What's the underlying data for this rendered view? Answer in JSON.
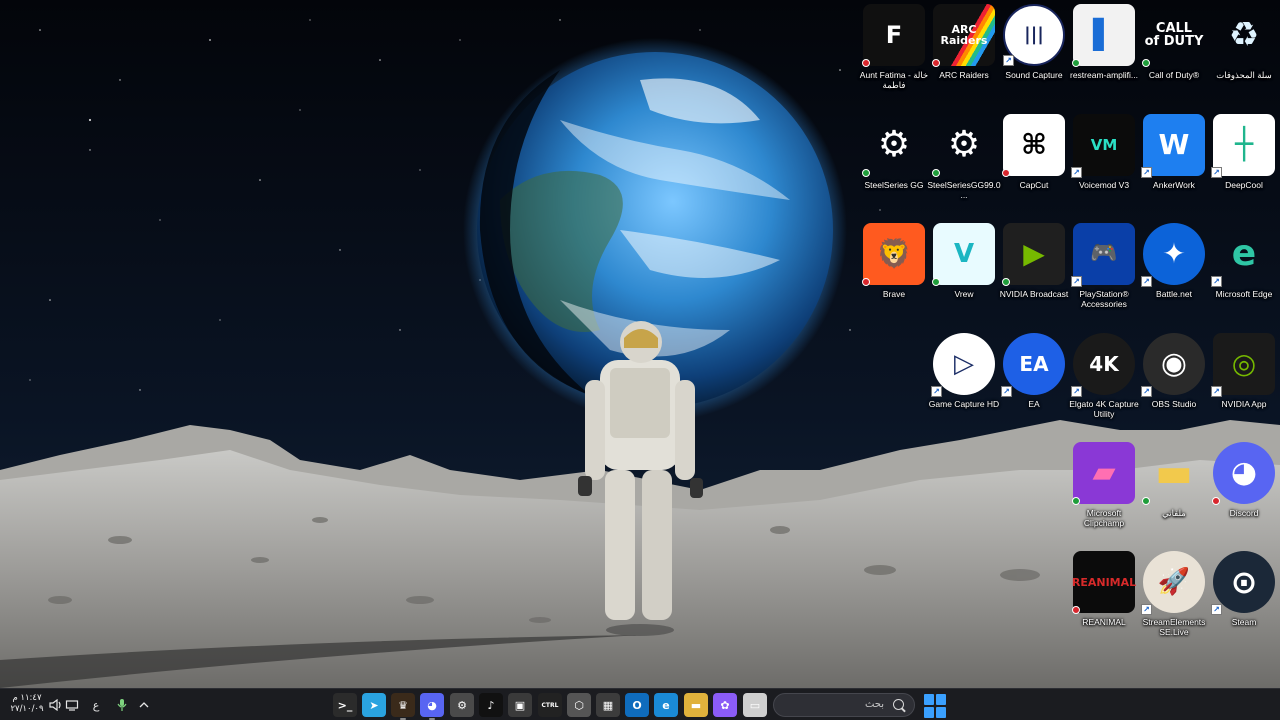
{
  "desktop": {
    "icons": [
      {
        "label": "Aunt Fatima - خالة فاطمة",
        "glyph": "F",
        "status": "err"
      },
      {
        "label": "ARC Raiders",
        "glyph": "ARC\nRaiders",
        "status": "err"
      },
      {
        "label": "Sound Capture",
        "glyph": "|||",
        "status": "shortcut"
      },
      {
        "label": "restream-amplifi...",
        "glyph": "▌",
        "status": "sync"
      },
      {
        "label": "Call of Duty®",
        "glyph": "CALL\nof DUTY",
        "status": "sync"
      },
      {
        "label": "سلة المحذوفات",
        "glyph": "♻",
        "status": "none"
      },
      {
        "label": "SteelSeries GG",
        "glyph": "⚙",
        "status": "sync"
      },
      {
        "label": "SteelSeriesGG99.0...",
        "glyph": "⚙",
        "status": "sync"
      },
      {
        "label": "CapCut",
        "glyph": "⌘",
        "status": "err"
      },
      {
        "label": "Voicemod V3",
        "glyph": "VM",
        "status": "shortcut"
      },
      {
        "label": "AnkerWork",
        "glyph": "W",
        "status": "shortcut"
      },
      {
        "label": "DeepCool",
        "glyph": "┼",
        "status": "shortcut"
      },
      {
        "label": "Brave",
        "glyph": "🦁",
        "status": "err"
      },
      {
        "label": "Vrew",
        "glyph": "V",
        "status": "sync"
      },
      {
        "label": "NVIDIA Broadcast",
        "glyph": "▶",
        "status": "sync"
      },
      {
        "label": "PlayStation® Accessories",
        "glyph": "🎮",
        "status": "shortcut"
      },
      {
        "label": "Battle.net",
        "glyph": "✦",
        "status": "shortcut"
      },
      {
        "label": "Microsoft Edge",
        "glyph": "e",
        "status": "shortcut"
      },
      {
        "label": "Game Capture HD",
        "glyph": "▷",
        "status": "shortcut"
      },
      {
        "label": "EA",
        "glyph": "EA",
        "status": "shortcut"
      },
      {
        "label": "Elgato 4K Capture Utility",
        "glyph": "4K",
        "status": "shortcut"
      },
      {
        "label": "OBS Studio",
        "glyph": "◉",
        "status": "shortcut"
      },
      {
        "label": "NVIDIA App",
        "glyph": "◎",
        "status": "shortcut"
      },
      {
        "label": "Microsoft Clipchamp",
        "glyph": "▰",
        "status": "sync"
      },
      {
        "label": "ملفاتي",
        "glyph": "▬",
        "status": "sync"
      },
      {
        "label": "Discord",
        "glyph": "◕",
        "status": "err"
      },
      {
        "label": "REANIMAL",
        "glyph": "REANIMAL",
        "status": "err"
      },
      {
        "label": "StreamElements SE.Live",
        "glyph": "🚀",
        "status": "shortcut"
      },
      {
        "label": "Steam",
        "glyph": "⊙",
        "status": "shortcut"
      }
    ]
  },
  "taskbar": {
    "search_placeholder": "بحث",
    "clock_time": "١١:٤٧ م",
    "clock_date": "٢٧/١٠/٠٩",
    "input_lang": "ع",
    "apps": [
      {
        "name": "terminal-app",
        "glyph": ">_"
      },
      {
        "name": "telegram-app",
        "glyph": "➤"
      },
      {
        "name": "app-with-badge",
        "glyph": "♛"
      },
      {
        "name": "discord-app",
        "glyph": "◕"
      },
      {
        "name": "settings-app",
        "glyph": "⚙"
      },
      {
        "name": "tiktok-app",
        "glyph": "♪"
      },
      {
        "name": "app-window",
        "glyph": "▣"
      },
      {
        "name": "ctrl-app",
        "glyph": "CTRL"
      },
      {
        "name": "hex-app",
        "glyph": "⬡"
      },
      {
        "name": "store-app",
        "glyph": "▦"
      },
      {
        "name": "outlook-app",
        "glyph": "O"
      },
      {
        "name": "edge-app",
        "glyph": "e"
      },
      {
        "name": "file-explorer-app",
        "glyph": "▬"
      },
      {
        "name": "copilot-app",
        "glyph": "✿"
      },
      {
        "name": "window-app",
        "glyph": "▭"
      }
    ]
  }
}
